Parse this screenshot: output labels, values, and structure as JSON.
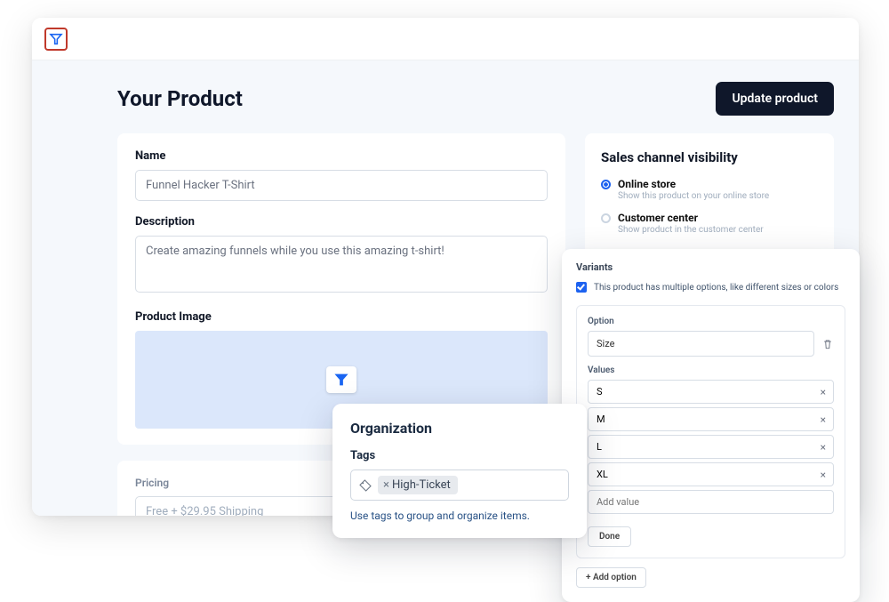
{
  "page": {
    "title": "Your Product",
    "update_button": "Update product"
  },
  "form": {
    "name_label": "Name",
    "name_value": "Funnel Hacker T-Shirt",
    "description_label": "Description",
    "description_value": "Create amazing funnels while you use this amazing t-shirt!",
    "product_image_label": "Product Image"
  },
  "pricing": {
    "label": "Pricing",
    "value": "Free + $29.95 Shipping"
  },
  "sales_channel": {
    "title": "Sales channel visibility",
    "items": [
      {
        "name": "Online store",
        "desc": "Show this product on your online store",
        "selected": true
      },
      {
        "name": "Customer center",
        "desc": "Show product in the customer center",
        "selected": false
      }
    ]
  },
  "variants": {
    "title": "Variants",
    "multiple_options_label": "This product has multiple options, like different sizes or colors",
    "option_label": "Option",
    "option_value": "Size",
    "values_label": "Values",
    "values": [
      "S",
      "M",
      "L",
      "XL"
    ],
    "add_value_placeholder": "Add value",
    "done": "Done",
    "add_option": "+ Add option"
  },
  "organization": {
    "title": "Organization",
    "tags_label": "Tags",
    "tags": [
      "High-Ticket"
    ],
    "hint": "Use tags to group and organize items."
  }
}
